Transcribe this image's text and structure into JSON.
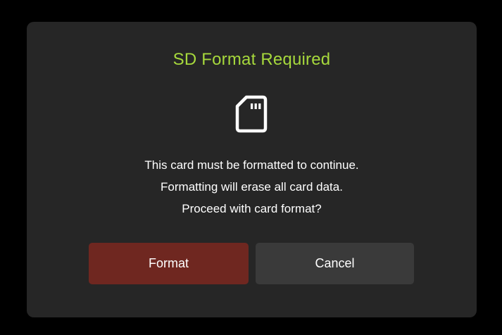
{
  "dialog": {
    "title": "SD Format Required",
    "icon": "sd-card-icon",
    "message_lines": [
      "This card must be formatted to continue.",
      "Formatting will erase all card data.",
      "Proceed with card format?"
    ]
  },
  "buttons": {
    "format_label": "Format",
    "cancel_label": "Cancel"
  },
  "colors": {
    "title": "#a6d83c",
    "format_button": "#6f2720",
    "cancel_button": "#3a3a3a",
    "dialog_background": "#262626"
  }
}
